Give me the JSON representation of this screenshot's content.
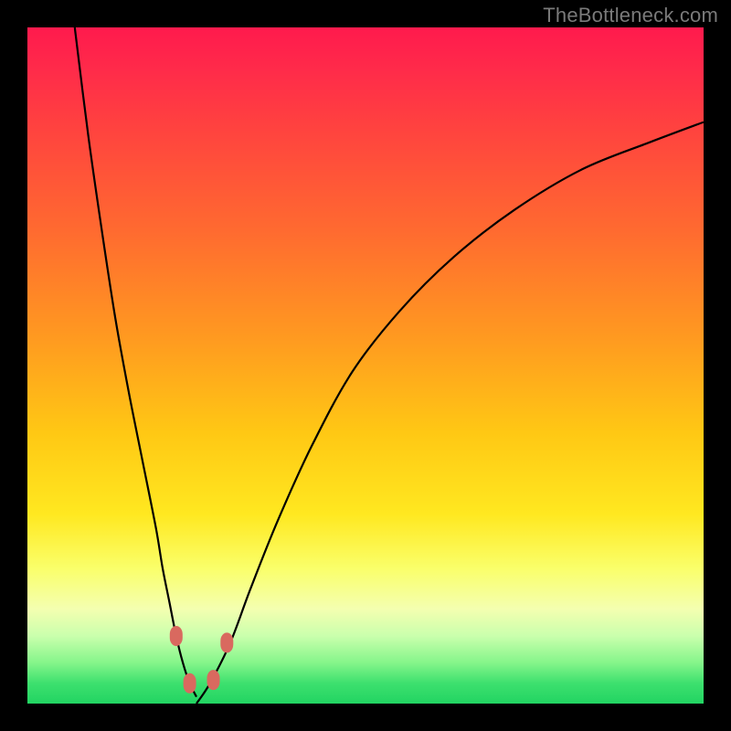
{
  "watermark": "TheBottleneck.com",
  "colors": {
    "frame": "#000000",
    "gradient_top": "#ff1a4d",
    "gradient_mid1": "#ff9a20",
    "gradient_mid2": "#ffe820",
    "gradient_bottom": "#22d462",
    "curve": "#000000",
    "marker": "#d9695f"
  },
  "chart_data": {
    "type": "line",
    "title": "",
    "xlabel": "",
    "ylabel": "",
    "xlim": [
      0,
      100
    ],
    "ylim": [
      0,
      100
    ],
    "grid": false,
    "series": [
      {
        "name": "bottleneck-curve-left",
        "x": [
          7,
          9,
          11,
          13,
          15,
          17,
          19,
          20,
          21,
          22,
          23,
          24,
          25
        ],
        "y": [
          100,
          84,
          70,
          57,
          46,
          36,
          26,
          20,
          15,
          10,
          6,
          3,
          1
        ]
      },
      {
        "name": "bottleneck-curve-right",
        "x": [
          25,
          27,
          30,
          33,
          37,
          42,
          48,
          55,
          63,
          72,
          82,
          92,
          100
        ],
        "y": [
          0,
          3,
          9,
          17,
          27,
          38,
          49,
          58,
          66,
          73,
          79,
          83,
          86
        ]
      }
    ],
    "markers": [
      {
        "name": "left-upper",
        "x": 22.0,
        "y": 10.0
      },
      {
        "name": "left-lower",
        "x": 24.0,
        "y": 3.0
      },
      {
        "name": "right-lower",
        "x": 27.5,
        "y": 3.5
      },
      {
        "name": "right-upper",
        "x": 29.5,
        "y": 9.0
      }
    ]
  }
}
